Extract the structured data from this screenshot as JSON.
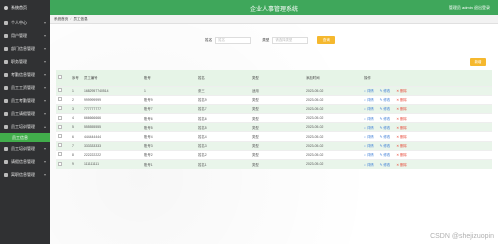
{
  "app": {
    "title": "企业人事管理系统",
    "user_info": "管理员 admin  退出登录"
  },
  "sidebar": {
    "items": [
      {
        "label": "系统首页",
        "type": "top"
      },
      {
        "label": "个人中心",
        "type": "group"
      },
      {
        "label": "用户管理",
        "type": "group"
      },
      {
        "label": "部门信息管理",
        "type": "group"
      },
      {
        "label": "职务管理",
        "type": "group"
      },
      {
        "label": "考勤信息管理",
        "type": "group"
      },
      {
        "label": "员工工资管理",
        "type": "group"
      },
      {
        "label": "员工考勤管理",
        "type": "group"
      },
      {
        "label": "员工请假管理",
        "type": "group"
      },
      {
        "label": "员工培训管理",
        "type": "group"
      },
      {
        "label": "员工信息",
        "type": "active"
      },
      {
        "label": "员工培训管理",
        "type": "group"
      },
      {
        "label": "请假信息管理",
        "type": "group"
      },
      {
        "label": "离职信息管理",
        "type": "group"
      }
    ]
  },
  "breadcrumb": {
    "home": "系统首页",
    "sep": "/",
    "current": "员工信息"
  },
  "search": {
    "name_label": "姓名",
    "name_placeholder": "姓名",
    "type_label": "类型",
    "type_placeholder": "请选择类型",
    "button": "查询"
  },
  "add_button": "新增",
  "table": {
    "headers": [
      "",
      "序号",
      "员工编号",
      "账号",
      "姓名",
      "类型",
      "添加时间",
      "操作"
    ],
    "rows": [
      {
        "no": "1",
        "emp_id": "1682957740514",
        "account": "1",
        "name": "张三",
        "type": "适用",
        "date": "2023-05-02"
      },
      {
        "no": "2",
        "emp_id": "999999999",
        "account": "账号9",
        "name": "姓名9",
        "type": "类型",
        "date": "2023-05-02"
      },
      {
        "no": "3",
        "emp_id": "777777777",
        "account": "账号7",
        "name": "姓名7",
        "type": "类型",
        "date": "2023-05-02"
      },
      {
        "no": "4",
        "emp_id": "666666666",
        "account": "账号6",
        "name": "姓名6",
        "type": "类型",
        "date": "2023-05-02"
      },
      {
        "no": "5",
        "emp_id": "555555555",
        "account": "账号5",
        "name": "姓名5",
        "type": "类型",
        "date": "2023-05-02"
      },
      {
        "no": "6",
        "emp_id": "444444444",
        "account": "账号4",
        "name": "姓名4",
        "type": "类型",
        "date": "2023-05-02"
      },
      {
        "no": "7",
        "emp_id": "333333333",
        "account": "账号3",
        "name": "姓名3",
        "type": "类型",
        "date": "2023-05-02"
      },
      {
        "no": "8",
        "emp_id": "222222222",
        "account": "账号2",
        "name": "姓名2",
        "type": "类型",
        "date": "2023-05-02"
      },
      {
        "no": "9",
        "emp_id": "111111111",
        "account": "账号1",
        "name": "姓名1",
        "type": "类型",
        "date": "2023-05-02"
      }
    ],
    "ops": {
      "view": "详情",
      "edit": "修改",
      "delete": "删除"
    }
  },
  "watermark": "CSDN @shejizuopin",
  "colors": {
    "sidebar": "#303133",
    "topbar": "#3fa75b",
    "accent": "#f5b82e",
    "row_tint": "#e9f5ea"
  }
}
